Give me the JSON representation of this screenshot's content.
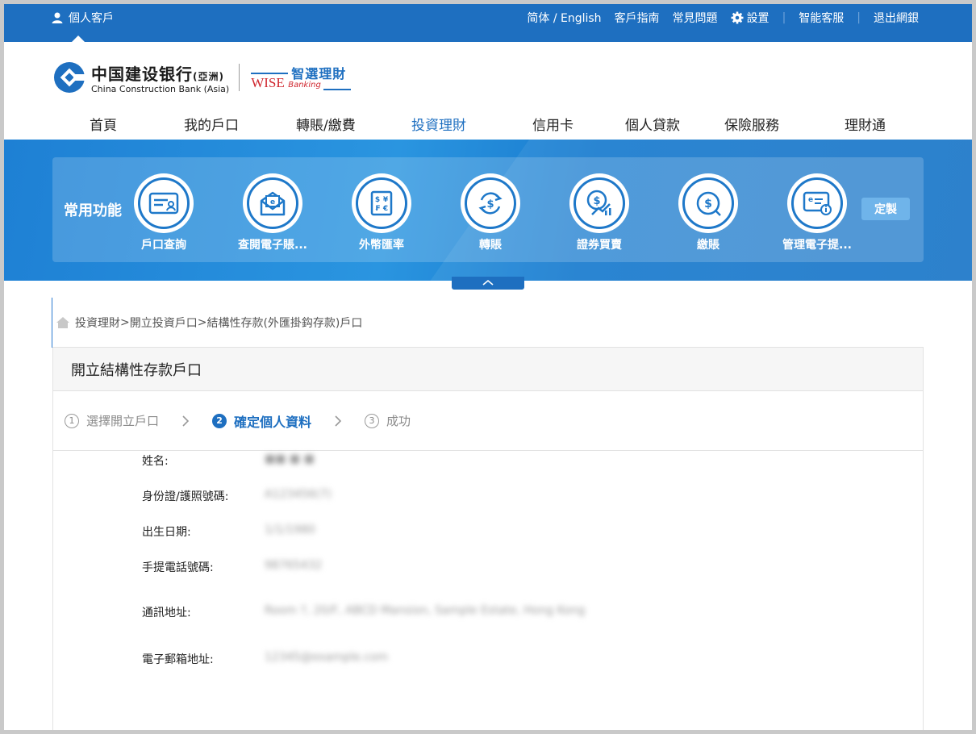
{
  "topbar": {
    "user_label": "個人客戶",
    "links": [
      "简体 / English",
      "客戶指南",
      "常見問題",
      "設置",
      "智能客服",
      "退出網銀"
    ]
  },
  "header": {
    "logo_cn": "中国建设银行",
    "logo_cn_suffix": "(亞洲)",
    "logo_en": "China Construction Bank (Asia)",
    "wise_en": "WISE",
    "wise_banking": "Banking",
    "wise_cn": "智選理財"
  },
  "nav": {
    "items": [
      "首頁",
      "我的戶口",
      "轉賬/繳費",
      "投資理財",
      "信用卡",
      "個人貸款",
      "保險服務",
      "理財通"
    ],
    "active_index": 3
  },
  "quick": {
    "title": "常用功能",
    "items": [
      {
        "label": "戶口查詢",
        "icon": "account-card-icon"
      },
      {
        "label": "查閱電子賬...",
        "icon": "e-statement-icon"
      },
      {
        "label": "外幣匯率",
        "icon": "currency-rate-icon"
      },
      {
        "label": "轉賬",
        "icon": "transfer-icon"
      },
      {
        "label": "證券買賣",
        "icon": "securities-trading-icon"
      },
      {
        "label": "繳賬",
        "icon": "bill-payment-icon"
      },
      {
        "label": "管理電子提...",
        "icon": "e-alert-icon"
      }
    ],
    "customize_label": "定製"
  },
  "breadcrumb": {
    "parts": [
      "投資理財",
      "開立投資戶口",
      "結構性存款(外匯掛鈎存款)戶口"
    ],
    "sep": "> "
  },
  "card": {
    "title": "開立結構性存款戶口",
    "steps": [
      {
        "num": "1",
        "label": "選擇開立戶口"
      },
      {
        "num": "2",
        "label": "確定個人資料"
      },
      {
        "num": "3",
        "label": "成功"
      }
    ],
    "active_step": 2,
    "fields": [
      {
        "label": "姓名:",
        "value": "■■ ■ ■"
      },
      {
        "label": "身份證/護照號碼:",
        "value": "A123456(7)"
      },
      {
        "label": "出生日期:",
        "value": "1/1/1980"
      },
      {
        "label": "手提電話號碼:",
        "value": "98765432"
      },
      {
        "label": "通訊地址:",
        "value": "Room ?, 20/F, ABCD Mansion, Sample Estate, Hong Kong"
      },
      {
        "label": "電子郵箱地址:",
        "value": "12345@example.com"
      }
    ]
  },
  "colors": {
    "brand_blue": "#1e6fc0",
    "banner_blue": "#2a95e0",
    "logo_red": "#d0272f"
  }
}
